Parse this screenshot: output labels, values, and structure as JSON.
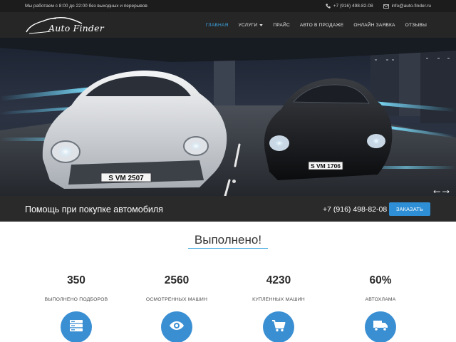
{
  "topbar": {
    "hours": "Мы работаем с 8:00 до 22:00 без выходных и перерывов",
    "phone": "+7 (916) 498-82-08",
    "email": "info@auto-finder.ru",
    "phone_icon": "phone-icon",
    "email_icon": "envelope-icon"
  },
  "header": {
    "brand": "Auto Finder",
    "nav": [
      {
        "label": "Главная",
        "active": true
      },
      {
        "label": "Услуги",
        "dropdown": true
      },
      {
        "label": "Прайс"
      },
      {
        "label": "Авто в продаже"
      },
      {
        "label": "Онлайн заявка"
      },
      {
        "label": "Отзывы"
      }
    ]
  },
  "hero": {
    "plate_left": "S VM 2507",
    "plate_right": "S VM 1706",
    "slides_count": 1,
    "active_slide": 1
  },
  "strip": {
    "tagline": "Помощь при покупке автомобиля",
    "phone": "+7 (916) 498-82-08",
    "button_label": "Заказать"
  },
  "stats_section": {
    "title": "Выполнено!",
    "items": [
      {
        "value": "350",
        "label": "выполнено подборов",
        "icon": "server-icon"
      },
      {
        "value": "2560",
        "label": "осмотренных машин",
        "icon": "eye-icon"
      },
      {
        "value": "4230",
        "label": "купленных машин",
        "icon": "cart-icon"
      },
      {
        "value": "60%",
        "label": "автохлама",
        "icon": "truck-icon"
      }
    ]
  },
  "colors": {
    "accent": "#3ea6e4",
    "button": "#2f8fd6",
    "icon_circle": "#3a8fd3",
    "header_bg": "#262626",
    "strip_bg": "#2a2a2a"
  }
}
